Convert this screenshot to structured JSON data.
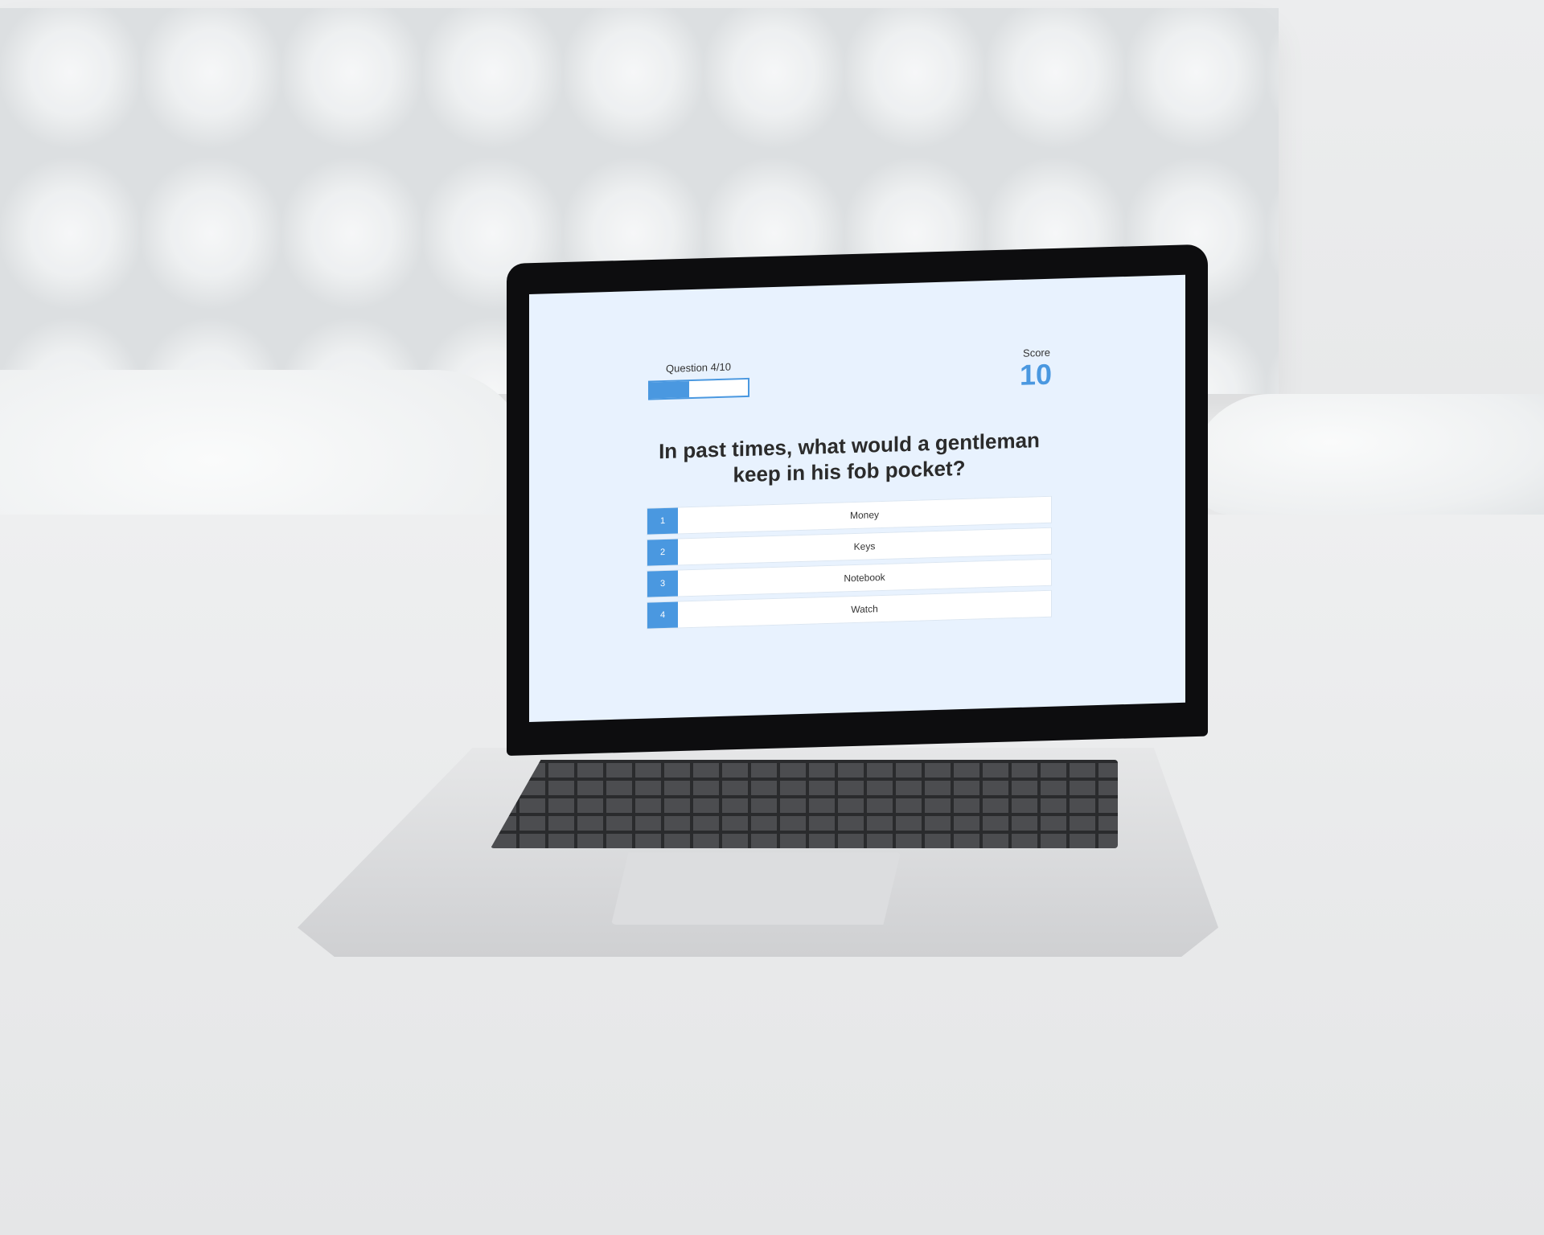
{
  "quiz": {
    "question_counter": "Question 4/10",
    "progress_fraction": 0.4,
    "score_label": "Score",
    "score_value": "10",
    "question": "In past times, what would a gentleman keep in his fob pocket?",
    "answers": [
      {
        "number": "1",
        "text": "Money"
      },
      {
        "number": "2",
        "text": "Keys"
      },
      {
        "number": "3",
        "text": "Notebook"
      },
      {
        "number": "4",
        "text": "Watch"
      }
    ]
  },
  "colors": {
    "accent": "#4a98e0",
    "screen_background": "#e8f2fe"
  }
}
